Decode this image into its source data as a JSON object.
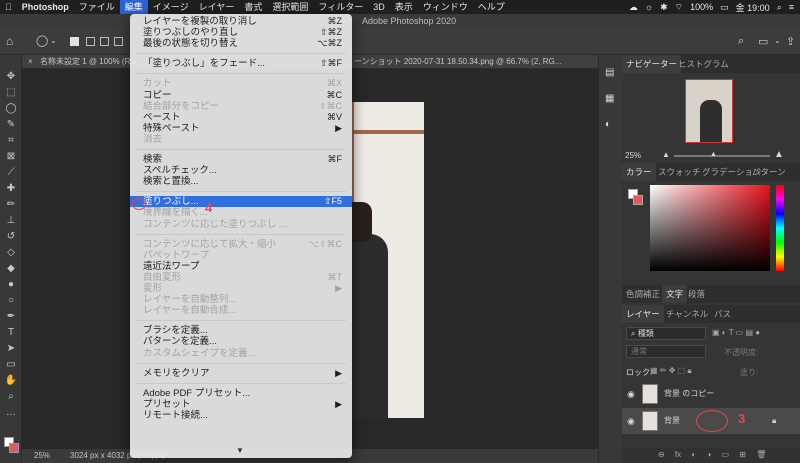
{
  "menubar": {
    "apple": "",
    "app": "Photoshop",
    "items": [
      "ファイル",
      "編集",
      "イメージ",
      "レイヤー",
      "書式",
      "選択範囲",
      "フィルター",
      "3D",
      "表示",
      "ウィンドウ",
      "ヘルプ"
    ],
    "active_index": 1,
    "battery": "100%",
    "clock": "金 19:00"
  },
  "window_title": "Adobe Photoshop 2020",
  "doc_tab": "名称未設定 1 @ 100% (RG",
  "doc_tab2": "ーンショット 2020-07-31 18.50.34.png @ 66.7% (2, RG...",
  "status": {
    "zoom": "25%",
    "size": "3024 px x 4032 px (72 ppi)"
  },
  "edit_menu": {
    "items": [
      {
        "label": "レイヤーを複製の取り消し",
        "shortcut": "⌘Z",
        "disabled": false
      },
      {
        "label": "塗りつぶしのやり直し",
        "shortcut": "⇧⌘Z",
        "disabled": false
      },
      {
        "label": "最後の状態を切り替え",
        "shortcut": "⌥⌘Z",
        "disabled": false
      },
      {
        "sep": true
      },
      {
        "label": "「塗りつぶし」をフェード...",
        "shortcut": "⇧⌘F",
        "disabled": false
      },
      {
        "sep": true
      },
      {
        "label": "カット",
        "shortcut": "⌘X",
        "disabled": true
      },
      {
        "label": "コピー",
        "shortcut": "⌘C",
        "disabled": false
      },
      {
        "label": "結合部分をコピー",
        "shortcut": "⇧⌘C",
        "disabled": true
      },
      {
        "label": "ペースト",
        "shortcut": "⌘V",
        "disabled": false
      },
      {
        "label": "特殊ペースト",
        "shortcut": "▶",
        "disabled": false
      },
      {
        "label": "消去",
        "shortcut": "",
        "disabled": true
      },
      {
        "sep": true
      },
      {
        "label": "検索",
        "shortcut": "⌘F",
        "disabled": false
      },
      {
        "label": "スペルチェック...",
        "shortcut": "",
        "disabled": false
      },
      {
        "label": "検索と置換...",
        "shortcut": "",
        "disabled": false
      },
      {
        "sep": true
      },
      {
        "label": "塗りつぶし...",
        "shortcut": "⇧F5",
        "disabled": false,
        "highlight": true
      },
      {
        "label": "境界線を描く...",
        "shortcut": "",
        "disabled": true
      },
      {
        "label": "コンテンツに応じた塗りつぶし ...",
        "shortcut": "",
        "disabled": true
      },
      {
        "sep": true
      },
      {
        "label": "コンテンツに応じて拡大・縮小",
        "shortcut": "⌥⇧⌘C",
        "disabled": true
      },
      {
        "label": "パペットワープ",
        "shortcut": "",
        "disabled": true
      },
      {
        "label": "遠近法ワープ",
        "shortcut": "",
        "disabled": false
      },
      {
        "label": "自由変形",
        "shortcut": "⌘T",
        "disabled": true
      },
      {
        "label": "変形",
        "shortcut": "▶",
        "disabled": true
      },
      {
        "label": "レイヤーを自動整列...",
        "shortcut": "",
        "disabled": true
      },
      {
        "label": "レイヤーを自動合成...",
        "shortcut": "",
        "disabled": true
      },
      {
        "sep": true
      },
      {
        "label": "ブラシを定義...",
        "shortcut": "",
        "disabled": false
      },
      {
        "label": "パターンを定義...",
        "shortcut": "",
        "disabled": false
      },
      {
        "label": "カスタムシェイプを定義...",
        "shortcut": "",
        "disabled": true
      },
      {
        "sep": true
      },
      {
        "label": "メモリをクリア",
        "shortcut": "▶",
        "disabled": false
      },
      {
        "sep": true
      },
      {
        "label": "Adobe PDF プリセット...",
        "shortcut": "",
        "disabled": false
      },
      {
        "label": "プリセット",
        "shortcut": "▶",
        "disabled": false
      },
      {
        "label": "リモート接続...",
        "shortcut": "",
        "disabled": false
      }
    ],
    "more_arrow": "▼"
  },
  "navigator": {
    "tabs": [
      "ナビゲーター",
      "ヒストグラム"
    ],
    "zoom": "25%"
  },
  "color_panel": {
    "tabs": [
      "カラー",
      "スウォッチ",
      "グラデーション",
      "パターン"
    ]
  },
  "adjust_tabs": [
    "色調補正",
    "文字",
    "段落"
  ],
  "layers_panel": {
    "tabs": [
      "レイヤー",
      "チャンネル",
      "パス"
    ],
    "filter": "種類",
    "blend_mode": "通常",
    "opacity_label": "不透明度:",
    "lock_label": "ロック:",
    "fill_label": "塗り:",
    "layers": [
      {
        "name": "背景 のコピー",
        "selected": false
      },
      {
        "name": "背景",
        "selected": true
      }
    ]
  },
  "annotations": {
    "step3": "3",
    "step4": "4"
  },
  "colors": {
    "accent": "#2f6fe0",
    "annotation": "#e5484d"
  }
}
